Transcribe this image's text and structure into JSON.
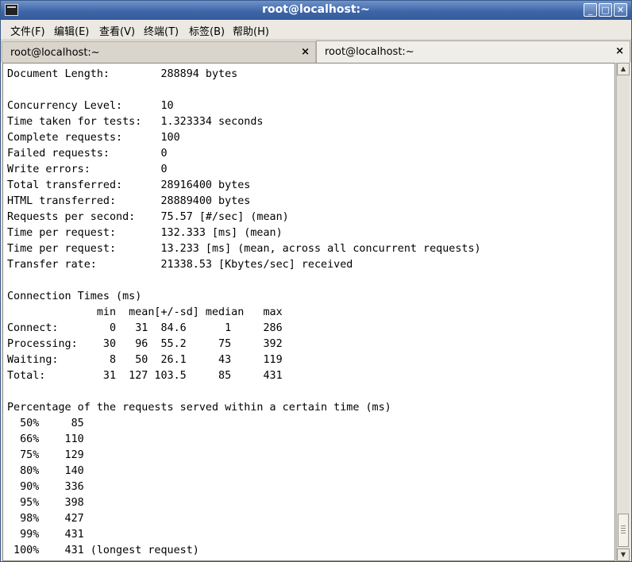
{
  "window": {
    "title": "root@localhost:~"
  },
  "titlebar_buttons": {
    "minimize": "_",
    "maximize": "□",
    "close": "✕"
  },
  "menu": [
    "文件(F)",
    "编辑(E)",
    "查看(V)",
    "终端(T)",
    "标签(B)",
    "帮助(H)"
  ],
  "tabs": [
    {
      "label": "root@localhost:~",
      "close": "×",
      "active": false
    },
    {
      "label": "root@localhost:~",
      "close": "×",
      "active": true
    }
  ],
  "terminal": {
    "lines": [
      "Document Length:        288894 bytes",
      "",
      "Concurrency Level:      10",
      "Time taken for tests:   1.323334 seconds",
      "Complete requests:      100",
      "Failed requests:        0",
      "Write errors:           0",
      "Total transferred:      28916400 bytes",
      "HTML transferred:       28889400 bytes",
      "Requests per second:    75.57 [#/sec] (mean)",
      "Time per request:       132.333 [ms] (mean)",
      "Time per request:       13.233 [ms] (mean, across all concurrent requests)",
      "Transfer rate:          21338.53 [Kbytes/sec] received",
      "",
      "Connection Times (ms)",
      "              min  mean[+/-sd] median   max",
      "Connect:        0   31  84.6      1     286",
      "Processing:    30   96  55.2     75     392",
      "Waiting:        8   50  26.1     43     119",
      "Total:         31  127 103.5     85     431",
      "",
      "Percentage of the requests served within a certain time (ms)",
      "  50%     85",
      "  66%    110",
      "  75%    129",
      "  80%    140",
      "  90%    336",
      "  95%    398",
      "  98%    427",
      "  99%    431",
      " 100%    431 (longest request)"
    ]
  },
  "scrollbar": {
    "up": "▲",
    "down": "▼",
    "position": 0.95
  }
}
